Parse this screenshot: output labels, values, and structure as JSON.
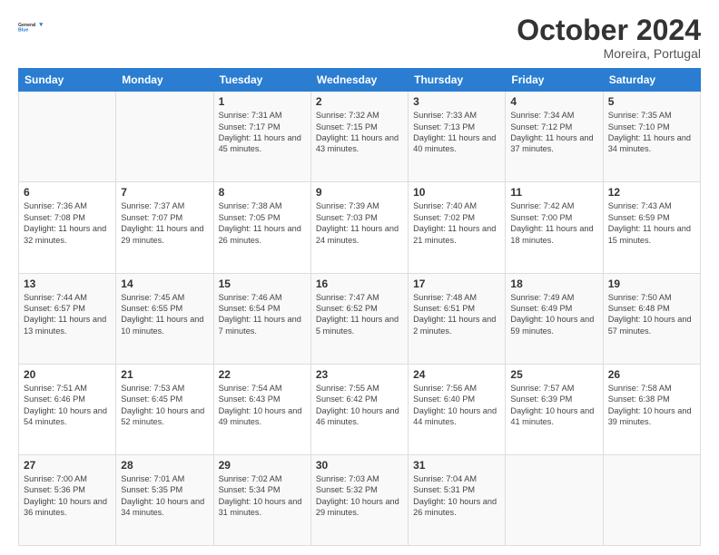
{
  "header": {
    "logo_line1": "General",
    "logo_line2": "Blue",
    "month": "October 2024",
    "location": "Moreira, Portugal"
  },
  "days_of_week": [
    "Sunday",
    "Monday",
    "Tuesday",
    "Wednesday",
    "Thursday",
    "Friday",
    "Saturday"
  ],
  "weeks": [
    [
      {
        "day": "",
        "sunrise": "",
        "sunset": "",
        "daylight": ""
      },
      {
        "day": "",
        "sunrise": "",
        "sunset": "",
        "daylight": ""
      },
      {
        "day": "1",
        "sunrise": "Sunrise: 7:31 AM",
        "sunset": "Sunset: 7:17 PM",
        "daylight": "Daylight: 11 hours and 45 minutes."
      },
      {
        "day": "2",
        "sunrise": "Sunrise: 7:32 AM",
        "sunset": "Sunset: 7:15 PM",
        "daylight": "Daylight: 11 hours and 43 minutes."
      },
      {
        "day": "3",
        "sunrise": "Sunrise: 7:33 AM",
        "sunset": "Sunset: 7:13 PM",
        "daylight": "Daylight: 11 hours and 40 minutes."
      },
      {
        "day": "4",
        "sunrise": "Sunrise: 7:34 AM",
        "sunset": "Sunset: 7:12 PM",
        "daylight": "Daylight: 11 hours and 37 minutes."
      },
      {
        "day": "5",
        "sunrise": "Sunrise: 7:35 AM",
        "sunset": "Sunset: 7:10 PM",
        "daylight": "Daylight: 11 hours and 34 minutes."
      }
    ],
    [
      {
        "day": "6",
        "sunrise": "Sunrise: 7:36 AM",
        "sunset": "Sunset: 7:08 PM",
        "daylight": "Daylight: 11 hours and 32 minutes."
      },
      {
        "day": "7",
        "sunrise": "Sunrise: 7:37 AM",
        "sunset": "Sunset: 7:07 PM",
        "daylight": "Daylight: 11 hours and 29 minutes."
      },
      {
        "day": "8",
        "sunrise": "Sunrise: 7:38 AM",
        "sunset": "Sunset: 7:05 PM",
        "daylight": "Daylight: 11 hours and 26 minutes."
      },
      {
        "day": "9",
        "sunrise": "Sunrise: 7:39 AM",
        "sunset": "Sunset: 7:03 PM",
        "daylight": "Daylight: 11 hours and 24 minutes."
      },
      {
        "day": "10",
        "sunrise": "Sunrise: 7:40 AM",
        "sunset": "Sunset: 7:02 PM",
        "daylight": "Daylight: 11 hours and 21 minutes."
      },
      {
        "day": "11",
        "sunrise": "Sunrise: 7:42 AM",
        "sunset": "Sunset: 7:00 PM",
        "daylight": "Daylight: 11 hours and 18 minutes."
      },
      {
        "day": "12",
        "sunrise": "Sunrise: 7:43 AM",
        "sunset": "Sunset: 6:59 PM",
        "daylight": "Daylight: 11 hours and 15 minutes."
      }
    ],
    [
      {
        "day": "13",
        "sunrise": "Sunrise: 7:44 AM",
        "sunset": "Sunset: 6:57 PM",
        "daylight": "Daylight: 11 hours and 13 minutes."
      },
      {
        "day": "14",
        "sunrise": "Sunrise: 7:45 AM",
        "sunset": "Sunset: 6:55 PM",
        "daylight": "Daylight: 11 hours and 10 minutes."
      },
      {
        "day": "15",
        "sunrise": "Sunrise: 7:46 AM",
        "sunset": "Sunset: 6:54 PM",
        "daylight": "Daylight: 11 hours and 7 minutes."
      },
      {
        "day": "16",
        "sunrise": "Sunrise: 7:47 AM",
        "sunset": "Sunset: 6:52 PM",
        "daylight": "Daylight: 11 hours and 5 minutes."
      },
      {
        "day": "17",
        "sunrise": "Sunrise: 7:48 AM",
        "sunset": "Sunset: 6:51 PM",
        "daylight": "Daylight: 11 hours and 2 minutes."
      },
      {
        "day": "18",
        "sunrise": "Sunrise: 7:49 AM",
        "sunset": "Sunset: 6:49 PM",
        "daylight": "Daylight: 10 hours and 59 minutes."
      },
      {
        "day": "19",
        "sunrise": "Sunrise: 7:50 AM",
        "sunset": "Sunset: 6:48 PM",
        "daylight": "Daylight: 10 hours and 57 minutes."
      }
    ],
    [
      {
        "day": "20",
        "sunrise": "Sunrise: 7:51 AM",
        "sunset": "Sunset: 6:46 PM",
        "daylight": "Daylight: 10 hours and 54 minutes."
      },
      {
        "day": "21",
        "sunrise": "Sunrise: 7:53 AM",
        "sunset": "Sunset: 6:45 PM",
        "daylight": "Daylight: 10 hours and 52 minutes."
      },
      {
        "day": "22",
        "sunrise": "Sunrise: 7:54 AM",
        "sunset": "Sunset: 6:43 PM",
        "daylight": "Daylight: 10 hours and 49 minutes."
      },
      {
        "day": "23",
        "sunrise": "Sunrise: 7:55 AM",
        "sunset": "Sunset: 6:42 PM",
        "daylight": "Daylight: 10 hours and 46 minutes."
      },
      {
        "day": "24",
        "sunrise": "Sunrise: 7:56 AM",
        "sunset": "Sunset: 6:40 PM",
        "daylight": "Daylight: 10 hours and 44 minutes."
      },
      {
        "day": "25",
        "sunrise": "Sunrise: 7:57 AM",
        "sunset": "Sunset: 6:39 PM",
        "daylight": "Daylight: 10 hours and 41 minutes."
      },
      {
        "day": "26",
        "sunrise": "Sunrise: 7:58 AM",
        "sunset": "Sunset: 6:38 PM",
        "daylight": "Daylight: 10 hours and 39 minutes."
      }
    ],
    [
      {
        "day": "27",
        "sunrise": "Sunrise: 7:00 AM",
        "sunset": "Sunset: 5:36 PM",
        "daylight": "Daylight: 10 hours and 36 minutes."
      },
      {
        "day": "28",
        "sunrise": "Sunrise: 7:01 AM",
        "sunset": "Sunset: 5:35 PM",
        "daylight": "Daylight: 10 hours and 34 minutes."
      },
      {
        "day": "29",
        "sunrise": "Sunrise: 7:02 AM",
        "sunset": "Sunset: 5:34 PM",
        "daylight": "Daylight: 10 hours and 31 minutes."
      },
      {
        "day": "30",
        "sunrise": "Sunrise: 7:03 AM",
        "sunset": "Sunset: 5:32 PM",
        "daylight": "Daylight: 10 hours and 29 minutes."
      },
      {
        "day": "31",
        "sunrise": "Sunrise: 7:04 AM",
        "sunset": "Sunset: 5:31 PM",
        "daylight": "Daylight: 10 hours and 26 minutes."
      },
      {
        "day": "",
        "sunrise": "",
        "sunset": "",
        "daylight": ""
      },
      {
        "day": "",
        "sunrise": "",
        "sunset": "",
        "daylight": ""
      }
    ]
  ]
}
